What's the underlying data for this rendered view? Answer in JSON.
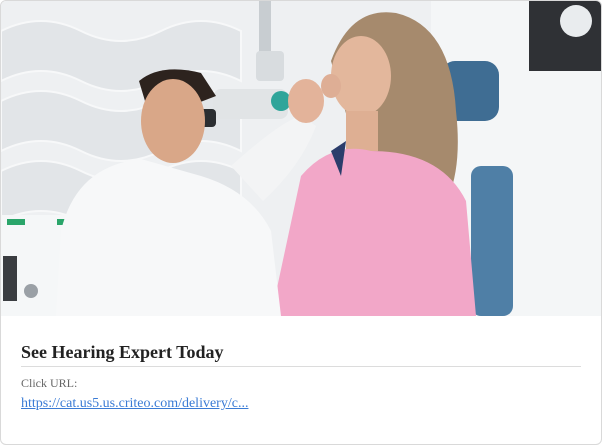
{
  "ad": {
    "image": {
      "icon": "hearing-exam-photo",
      "alt": ""
    },
    "title": "See Hearing Expert Today",
    "url_caption": "Click URL:",
    "url_text": "https://cat.us5.us.criteo.com/delivery/c..."
  },
  "colors": {
    "link": "#3a7bd5",
    "title": "#222222",
    "caption": "#666666",
    "chair": "#3f6d93",
    "shirt_pink": "#f2a7c8"
  }
}
